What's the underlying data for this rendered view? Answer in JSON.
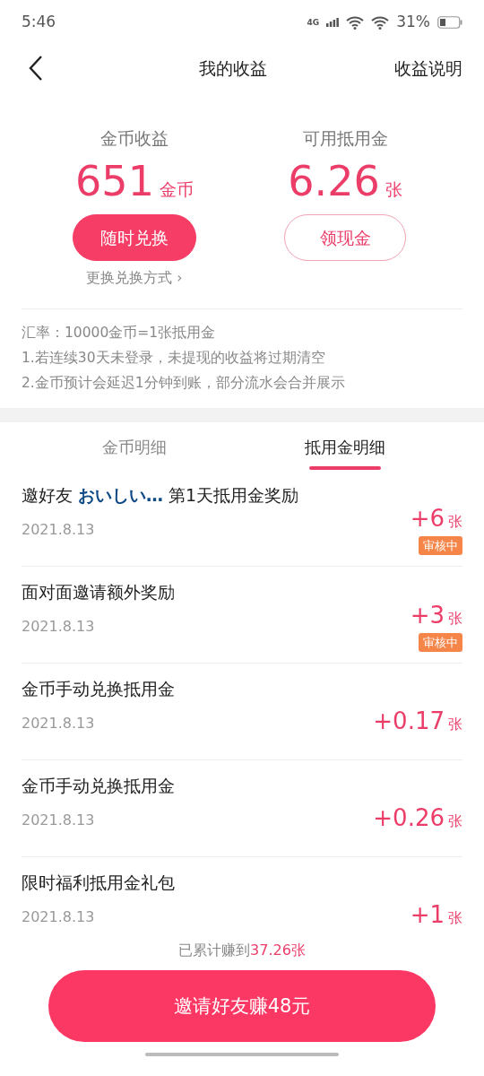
{
  "status_bar": {
    "time": "5:46",
    "network": "4G",
    "battery": "31%"
  },
  "header": {
    "title": "我的收益",
    "action": "收益说明"
  },
  "summary": [
    {
      "label": "金币收益",
      "value": "651",
      "unit": "金币",
      "button": "随时兑换",
      "kind": "filled",
      "link": "更换兑换方式 ›"
    },
    {
      "label": "可用抵用金",
      "value": "6.26",
      "unit": "张",
      "button": "领现金",
      "kind": "outline"
    }
  ],
  "notes": [
    "汇率：10000金币=1张抵用金",
    "1.若连续30天未登录，未提现的收益将过期清空",
    "2.金币预计会延迟1分钟到账，部分流水会合并展示"
  ],
  "tabs": [
    {
      "label": "金币明细",
      "selected": false
    },
    {
      "label": "抵用金明细",
      "selected": true
    }
  ],
  "records": [
    {
      "title": "邀好友 **おいしい…** 第1天抵用金奖励",
      "date": "2021.8.13",
      "amount": "+6",
      "unit": "张",
      "badge": "审核中"
    },
    {
      "title": "面对面邀请额外奖励",
      "date": "2021.8.13",
      "amount": "+3",
      "unit": "张",
      "badge": "审核中"
    },
    {
      "title": "金币手动兑换抵用金",
      "date": "2021.8.13",
      "amount": "+0.17",
      "unit": "张"
    },
    {
      "title": "金币手动兑换抵用金",
      "date": "2021.8.13",
      "amount": "+0.26",
      "unit": "张"
    },
    {
      "title": "限时福利抵用金礼包",
      "date": "2021.8.13",
      "amount": "+1",
      "unit": "张"
    }
  ],
  "footer": {
    "total_label": "已累计赚到",
    "total_value": "37.26张",
    "button": "邀请好友赚48元"
  }
}
